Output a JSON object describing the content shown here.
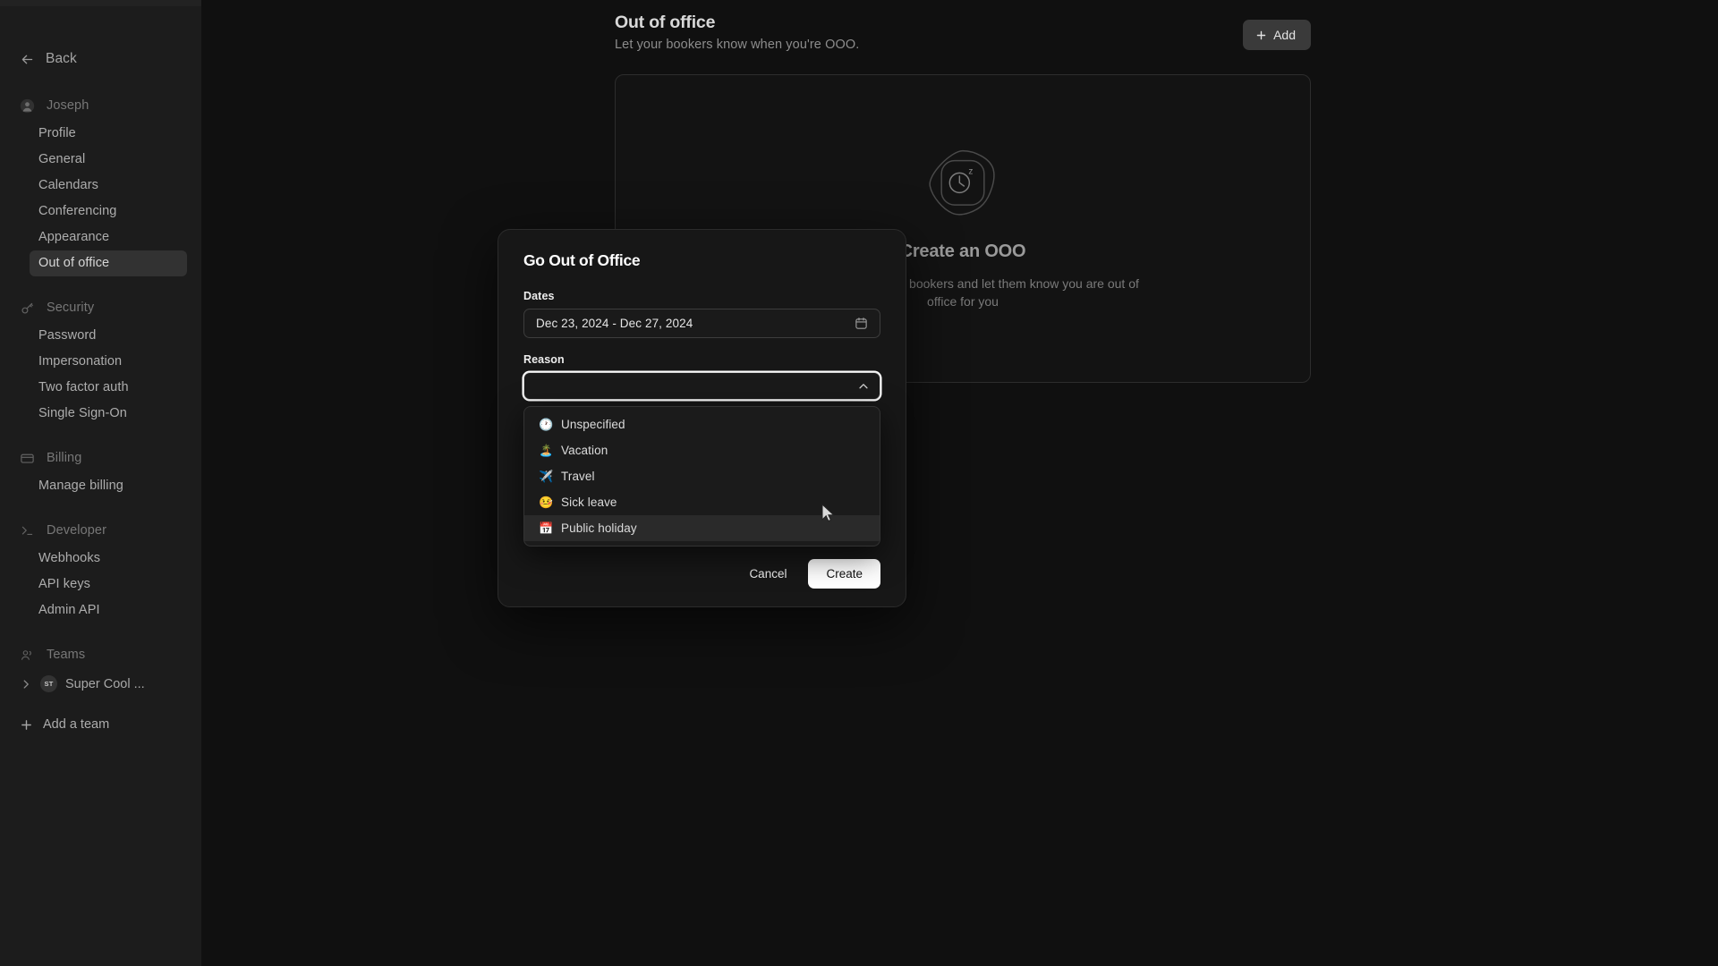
{
  "sidebar": {
    "back_label": "Back",
    "groups": [
      {
        "title": "Joseph",
        "icon": "user-avatar-icon",
        "items": [
          {
            "label": "Profile",
            "active": false
          },
          {
            "label": "General",
            "active": false
          },
          {
            "label": "Calendars",
            "active": false
          },
          {
            "label": "Conferencing",
            "active": false
          },
          {
            "label": "Appearance",
            "active": false
          },
          {
            "label": "Out of office",
            "active": true
          }
        ]
      },
      {
        "title": "Security",
        "icon": "key-icon",
        "items": [
          {
            "label": "Password",
            "active": false
          },
          {
            "label": "Impersonation",
            "active": false
          },
          {
            "label": "Two factor auth",
            "active": false
          },
          {
            "label": "Single Sign-On",
            "active": false
          }
        ]
      },
      {
        "title": "Billing",
        "icon": "credit-card-icon",
        "items": [
          {
            "label": "Manage billing",
            "active": false
          }
        ]
      },
      {
        "title": "Developer",
        "icon": "terminal-icon",
        "items": [
          {
            "label": "Webhooks",
            "active": false
          },
          {
            "label": "API keys",
            "active": false
          },
          {
            "label": "Admin API",
            "active": false
          }
        ]
      }
    ],
    "teams": {
      "title": "Teams",
      "icon": "users-icon",
      "team_name": "Super Cool ...",
      "team_initials": "ST",
      "add_team_label": "Add a team"
    }
  },
  "main": {
    "title": "Out of office",
    "subtitle": "Let your bookers know when you're OOO.",
    "add_button_label": "Add",
    "empty_state": {
      "title": "Create an OOO",
      "description": "Communicate to your bookers and let them know you are out of office for you"
    }
  },
  "modal": {
    "title": "Go Out of Office",
    "dates_label": "Dates",
    "dates_value": "Dec 23, 2024 - Dec 27, 2024",
    "reason_label": "Reason",
    "reason_value": "",
    "reason_placeholder": "",
    "options": [
      {
        "emoji": "🕐",
        "label": "Unspecified",
        "highlighted": false
      },
      {
        "emoji": "🏝️",
        "label": "Vacation",
        "highlighted": false
      },
      {
        "emoji": "✈️",
        "label": "Travel",
        "highlighted": false
      },
      {
        "emoji": "🤒",
        "label": "Sick leave",
        "highlighted": false
      },
      {
        "emoji": "📅",
        "label": "Public holiday",
        "highlighted": true
      }
    ],
    "cancel_label": "Cancel",
    "create_label": "Create"
  },
  "colors": {
    "background": "#101010",
    "sidebar": "#1c1c1c",
    "modal": "#171717",
    "active_nav": "#323232",
    "primary_button": "#ffffff",
    "focus_ring": "#ffffff"
  }
}
